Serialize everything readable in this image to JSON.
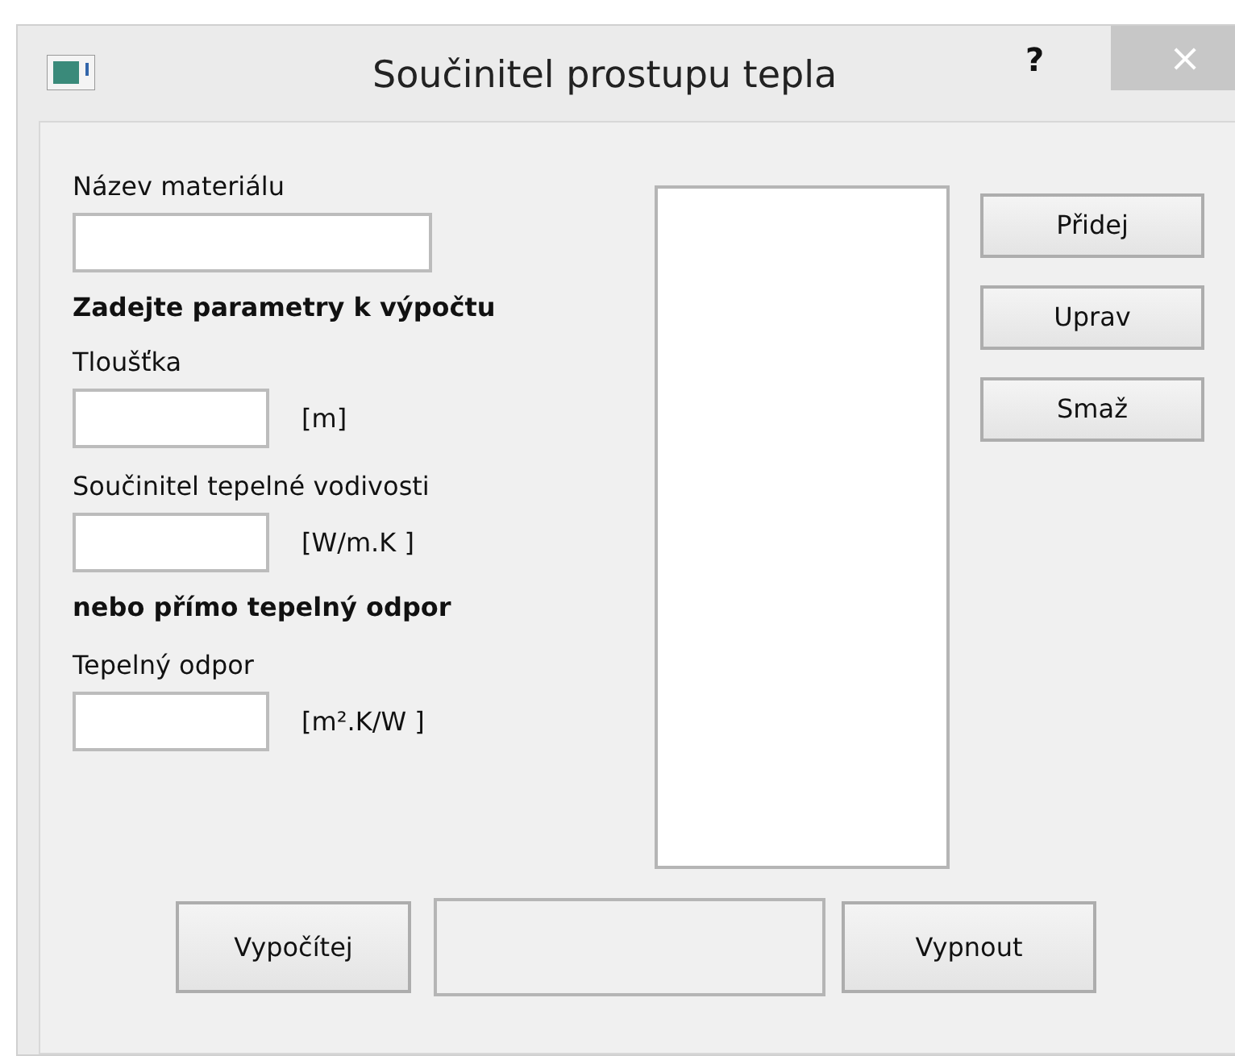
{
  "window": {
    "title": "Součinitel prostupu tepla",
    "help": "?",
    "close": "×"
  },
  "name_field": {
    "label": "Název materiálu"
  },
  "heading": "Zadejte parametry k výpočtu",
  "params": [
    {
      "label": "Tloušťka",
      "unit": "[m]"
    },
    {
      "label": "Součinitel tepelné vodivosti",
      "unit": "[W/m.K ]"
    }
  ],
  "alt_heading": "nebo přímo tepelný odpor",
  "resistance": {
    "label": "Tepelný odpor",
    "unit": "[m².K/W ]"
  },
  "side_buttons": [
    "Přidej",
    "Uprav",
    "Smaž"
  ],
  "bottom": {
    "compute": "Vypočítej",
    "quit": "Vypnout"
  }
}
